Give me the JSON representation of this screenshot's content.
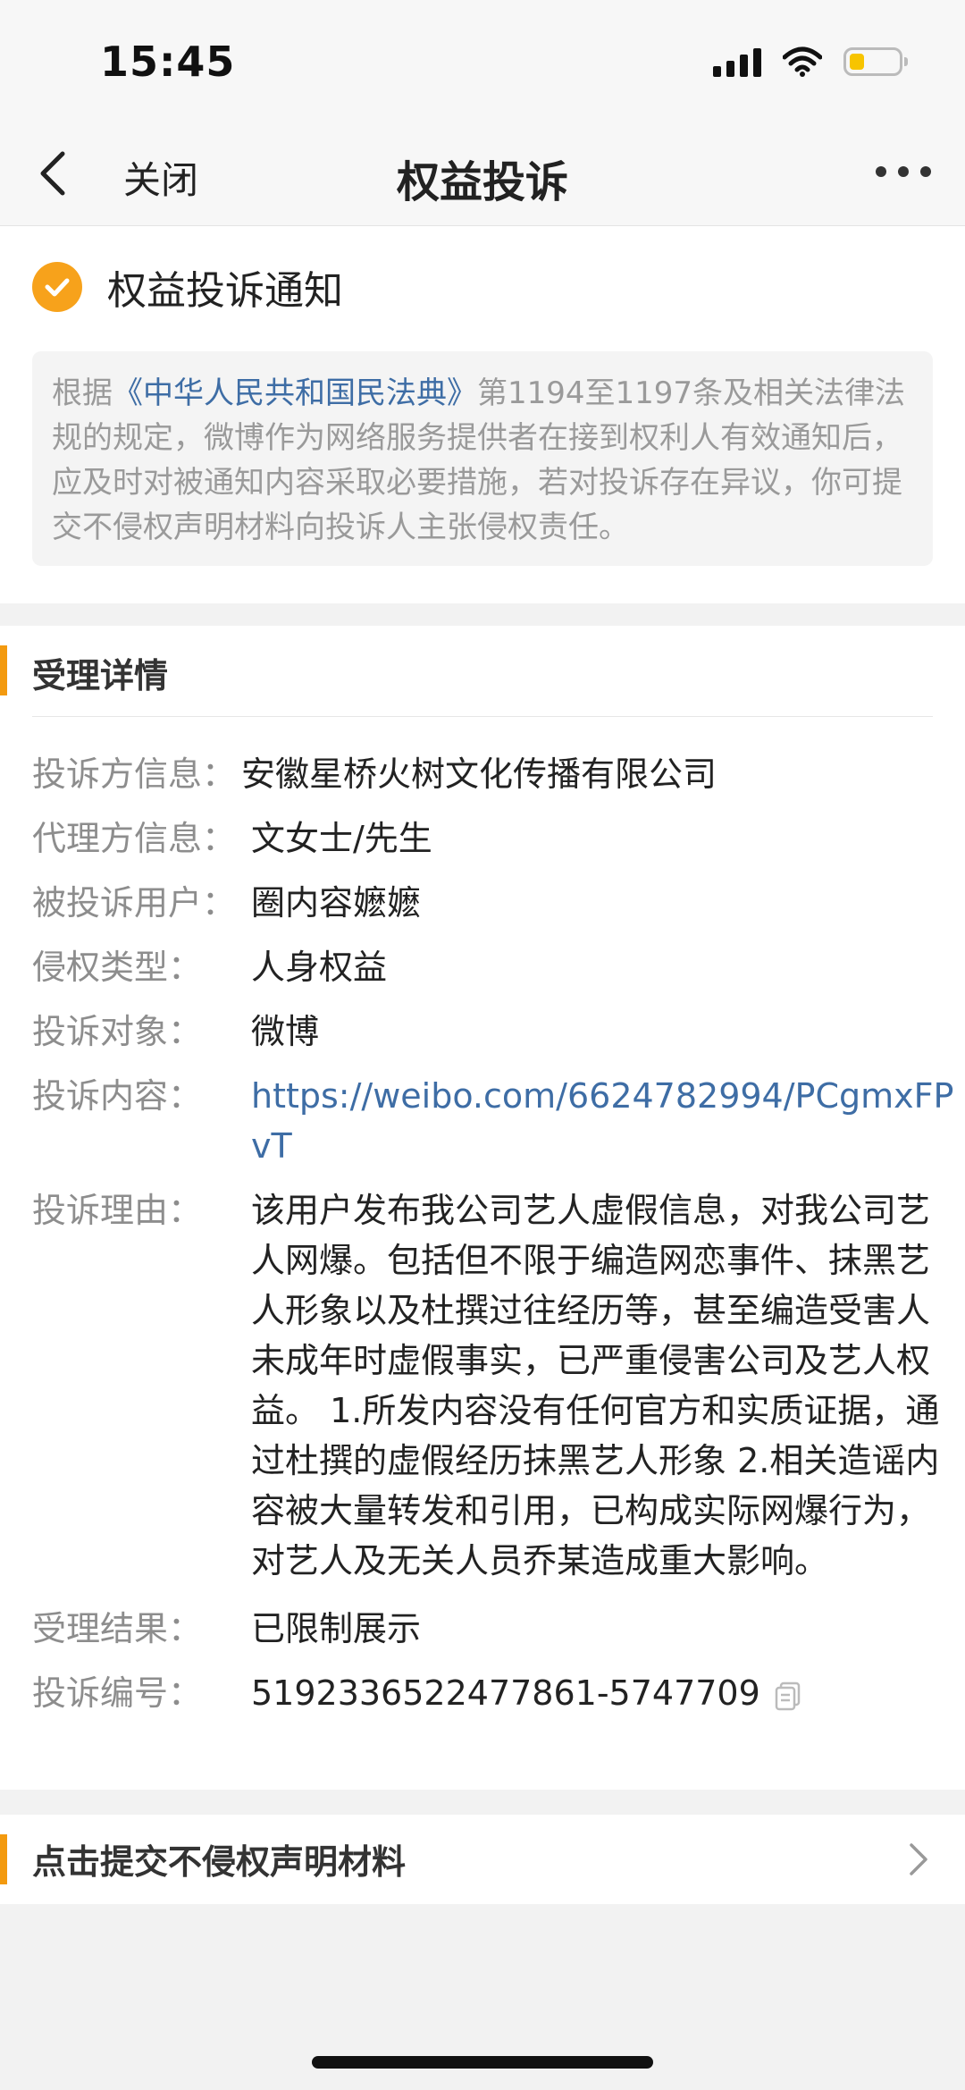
{
  "status_bar": {
    "time": "15:45"
  },
  "nav": {
    "close_label": "关闭",
    "title": "权益投诉"
  },
  "notice": {
    "title": "权益投诉通知",
    "text_before": "根据",
    "law_link": "《中华人民共和国民法典》",
    "text_after": "第1194至1197条及相关法律法规的规定，微博作为网络服务提供者在接到权利人有效通知后，应及时对被通知内容采取必要措施，若对投诉存在异议，你可提交不侵权声明材料向投诉人主张侵权责任。"
  },
  "details": {
    "section_title": "受理详情",
    "rows": [
      {
        "label": "投诉方信息：",
        "value": "安徽星桥火树文化传播有限公司"
      },
      {
        "label": "代理方信息：",
        "value": "文女士/先生"
      },
      {
        "label": "被投诉用户：",
        "value": "圈内容嬷嬷"
      },
      {
        "label": "侵权类型：",
        "value": "人身权益"
      },
      {
        "label": "投诉对象：",
        "value": "微博"
      },
      {
        "label": "投诉内容：",
        "value": "https://weibo.com/6624782994/PCgmxFPvT"
      },
      {
        "label": "投诉理由：",
        "value": "该用户发布我公司艺人虚假信息，对我公司艺人网爆。包括但不限于编造网恋事件、抹黑艺人形象以及杜撰过往经历等，甚至编造受害人未成年时虚假事实，已严重侵害公司及艺人权益。 1.所发内容没有任何官方和实质证据，通过杜撰的虚假经历抹黑艺人形象 2.相关造谣内容被大量转发和引用，已构成实际网爆行为，对艺人及无关人员乔某造成重大影响。"
      },
      {
        "label": "受理结果：",
        "value": "已限制展示"
      },
      {
        "label": "投诉编号：",
        "value": "5192336522477861-5747709"
      }
    ]
  },
  "submit": {
    "label": "点击提交不侵权声明材料"
  },
  "colors": {
    "accent": "#f39a0f",
    "link": "#3e6da5",
    "check": "#f7a21b"
  }
}
